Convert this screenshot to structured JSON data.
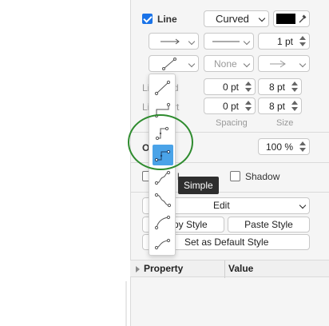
{
  "line_section": {
    "line_label": "Line",
    "line_checked": true,
    "edge_style_value": "Curved",
    "line_color": "#000000",
    "pattern_select": "———",
    "width_value": "1 pt",
    "waypoints_select": "None",
    "line_start_value": "0 pt",
    "line_start_size": "8 pt",
    "line_end_value": "0 pt",
    "line_end_size": "8 pt",
    "line_start_label": "Li",
    "line_start_label_tail": "d",
    "line_end_label": "Li",
    "line_end_label_tail": "rt",
    "spacing_label": "Spacing",
    "size_label": "Size"
  },
  "opacity": {
    "label": "O",
    "value": "100 %"
  },
  "options": {
    "rounded_partial": "l",
    "shadow_label": "Shadow",
    "shadow_checked": false
  },
  "actions": {
    "edit_label": "Edit",
    "copy_style_label": "py Style",
    "paste_style_label": "Paste Style",
    "default_style_label": "Set as Default Style"
  },
  "property_table": {
    "col_property": "Property",
    "col_value": "Value"
  },
  "waypoint_popup": {
    "selected_index": 3,
    "items": [
      "straight",
      "orthogonal",
      "simple",
      "isometric",
      "curved",
      "entity-relation",
      "horizontal-curve",
      "vertical-curve"
    ]
  },
  "tooltip": {
    "text": "Simple"
  },
  "highlight_color": "#2e8b2e",
  "accent_color": "#1a73e8",
  "selected_item_color": "#4aa3e8"
}
